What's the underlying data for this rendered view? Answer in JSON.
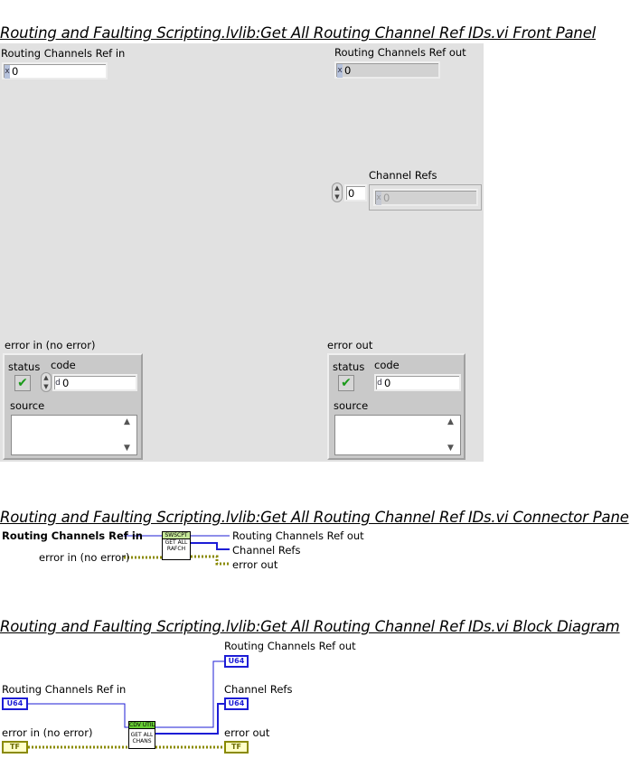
{
  "front_panel": {
    "title": "Routing and Faulting Scripting.lvlib:Get All Routing Channel Ref IDs.vi Front Panel",
    "routing_in": {
      "label": "Routing Channels Ref in",
      "radix": "x",
      "value": "0"
    },
    "routing_out": {
      "label": "Routing Channels Ref out",
      "radix": "x",
      "value": "0"
    },
    "channel_refs": {
      "label": "Channel Refs",
      "index": "0",
      "radix": "x",
      "value": "0"
    },
    "error_in": {
      "label": "error in (no error)",
      "status_label": "status",
      "code_label": "code",
      "code_radix": "d",
      "code_value": "0",
      "source_label": "source"
    },
    "error_out": {
      "label": "error out",
      "status_label": "status",
      "code_label": "code",
      "code_radix": "d",
      "code_value": "0",
      "source_label": "source"
    }
  },
  "connector_pane": {
    "title": "Routing and Faulting Scripting.lvlib:Get All Routing Channel Ref IDs.vi Connector Pane",
    "in_routing": "Routing Channels Ref in",
    "in_error": "error in (no error)",
    "out_routing": "Routing Channels Ref out",
    "out_channels": "Channel Refs",
    "out_error": "error out",
    "icon_header": "SWSCPT",
    "icon_body": "GET ALL RAFCH"
  },
  "block_diagram": {
    "title": "Routing and Faulting Scripting.lvlib:Get All Routing Channel Ref IDs.vi Block Diagram",
    "routing_out": "Routing Channels Ref out",
    "channel_refs": "Channel Refs",
    "routing_in": "Routing Channels Ref in",
    "error_in": "error in (no error)",
    "error_out": "error out",
    "u64_term": "U64",
    "err_term": "TF",
    "subvi_header": "CDV UTIL",
    "subvi_body": "GET ALL CHANS"
  },
  "colors": {
    "u64_wire": "#1d1dd6",
    "error_wire": "#8a8a00",
    "panel_bg": "#e1e1e1",
    "status_green": "#1a9a1a"
  }
}
